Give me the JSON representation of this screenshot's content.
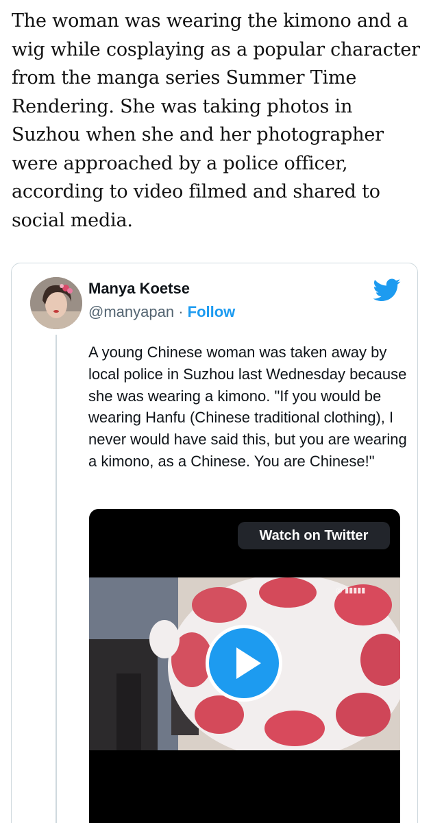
{
  "article": {
    "paragraph": "The woman was wearing the kimono and a wig while cosplaying as a popular character from the manga series Summer Time Rendering. She was taking photos in Suzhou when she and her photographer were approached by a police officer, according to video filmed and shared to social media."
  },
  "tweet": {
    "author_name": "Manya Koetse",
    "handle": "@manyapan",
    "separator": " · ",
    "follow_label": "Follow",
    "text": "A young Chinese woman was taken away by local police in Suzhou last Wednesday because she was wearing a kimono. \"If you would be wearing Hanfu (Chinese traditional clothing), I never would have said this, but you are wearing a kimono, as a Chinese. You are Chinese!\"",
    "video": {
      "watch_label": "Watch on Twitter",
      "watermark_icon": "weibo-icon"
    }
  },
  "colors": {
    "twitter_blue": "#1d9bf0",
    "text_primary": "#0f1419",
    "text_secondary": "#536471",
    "border": "#cfd9de"
  },
  "icons": {
    "brand": "twitter-bird-icon",
    "play": "play-icon"
  }
}
